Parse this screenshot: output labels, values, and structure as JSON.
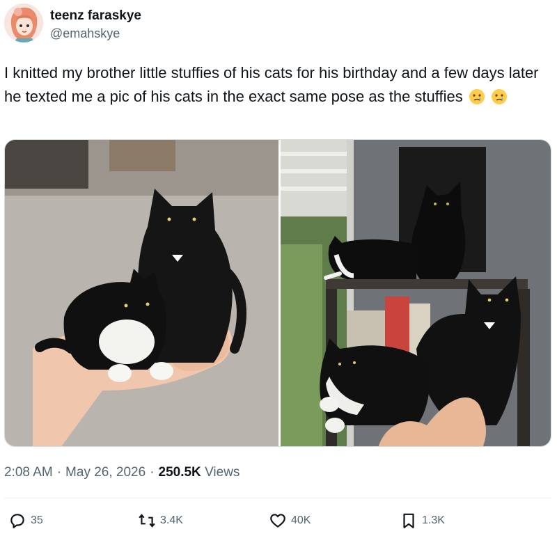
{
  "user": {
    "display_name": "teenz faraskye",
    "handle": "@emahskye"
  },
  "tweet": {
    "text": "I knitted my brother little stuffies of his cats for his birthday and a few days later he texted me a pic of his cats in the exact same pose as the stuffies",
    "emojis": [
      "crying-face-icon",
      "crying-face-icon"
    ]
  },
  "meta": {
    "time": "2:08 AM",
    "date": "May 26, 2026",
    "views_count": "250.5K",
    "views_label": "Views",
    "separator": "·"
  },
  "actions": {
    "replies": "35",
    "retweets": "3.4K",
    "likes": "40K",
    "bookmarks": "1.3K"
  },
  "colors": {
    "text": "#0f1419",
    "secondary": "#536471",
    "divider": "#eff3f4"
  }
}
